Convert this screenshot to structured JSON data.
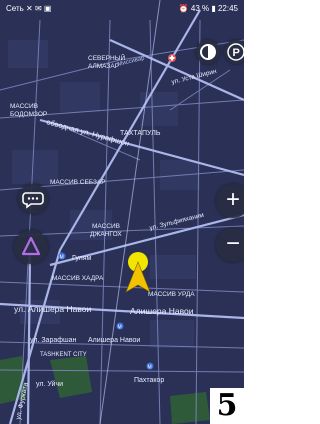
{
  "status_bar": {
    "left_text": "Сеть ✕ ✉ ▣",
    "right_text": "⏰ 43 % ▮ 22:45"
  },
  "colors": {
    "map_background": "#2b3156",
    "road": "#9aa6dc",
    "major_road": "#7f88c4",
    "park": "#2f5a3a",
    "location_marker": "#f2e600",
    "pointer": "#f2c200"
  },
  "map_labels": {
    "severny_almazar": "СЕВЕРНЫЙ\nАЛМАЗАР",
    "st_mirzo": "Миссивар",
    "ul_usta_shirin": "ул. Уста Ширин",
    "massiv_bodomzor": "МАССИВ\nБОДОМЗОР",
    "tahtapul": "ТАХТАПУЛЬ",
    "obvodnaya_nurafshon": "обводная ул. Нурафшон",
    "massiv_sebzar": "МАССИВ СЕБЗАР",
    "ul_zulfiyahonim": "ул. Зульфияханим",
    "massiv_dzhangoh": "МАССИВ\nДЖАНГОХ",
    "gulyam": "Гулям",
    "massiv_hadra": "МАССИВ ХАДРА",
    "massiv_urda": "МАССИВ УРДА",
    "ul_alishera_navoi_1": "ул. Алишера Навои",
    "ul_alishera_navoi_2": "Алишера Навои",
    "ul_alishera_navoi_3": "ул. Алишера Навои",
    "ul_zarafshan": "ул. Зарафшан",
    "tashkent_city": "TASHKENT CITY",
    "ul_uychi": "ул. Уйчи",
    "pakhtakor": "Пахтакор",
    "ul_furkata": "ул. Фурката"
  },
  "controls": {
    "zoom_in": "+",
    "zoom_out": "−",
    "parking": "P"
  },
  "corner_tag": "5"
}
